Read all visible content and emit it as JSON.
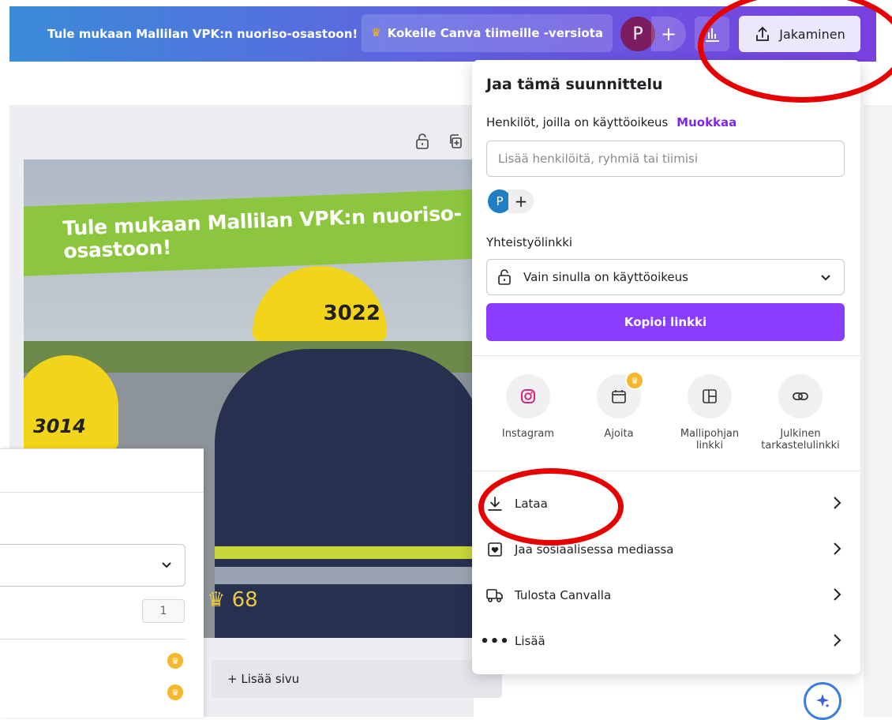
{
  "header": {
    "promo_text": "Tule mukaan Mallilan VPK:n nuoriso-osastoon!",
    "try_teams_label": "Kokeile Canva tiimeille -versiota",
    "avatar_letter": "P",
    "share_label": "Jakaminen"
  },
  "canvas": {
    "banner_text": "Tule mukaan Mallilan VPK:n nuoriso-osastoon!",
    "helmet_numbers": [
      "3022",
      "3014"
    ],
    "crest_number": "68",
    "add_page_label": "+ Lisää sivu"
  },
  "left_panel": {
    "page_count": "1"
  },
  "share_panel": {
    "title": "Jaa tämä suunnittelu",
    "access_label": "Henkilöt, joilla on käyttöoikeus",
    "edit_link": "Muokkaa",
    "people_placeholder": "Lisää henkilöitä, ryhmiä tai tiimisi",
    "avatar_letter": "P",
    "collab_link_label": "Yhteistyölinkki",
    "access_option": "Vain sinulla on käyttöoikeus",
    "copy_link_label": "Kopioi linkki",
    "options": [
      {
        "label": "Instagram",
        "icon": "instagram-icon"
      },
      {
        "label": "Ajoita",
        "icon": "calendar-icon"
      },
      {
        "label": "Mallipohjan linkki",
        "icon": "template-icon"
      },
      {
        "label": "Julkinen tarkastelulinkki",
        "icon": "link-icon"
      }
    ],
    "rows": [
      {
        "label": "Lataa",
        "icon": "download-icon"
      },
      {
        "label": "Jaa sosiaalisessa mediassa",
        "icon": "heart-icon"
      },
      {
        "label": "Tulosta Canvalla",
        "icon": "truck-icon"
      },
      {
        "label": "Lisää",
        "icon": "more-icon"
      }
    ]
  },
  "colors": {
    "accent": "#8b3dff",
    "annotation": "#e60000"
  }
}
